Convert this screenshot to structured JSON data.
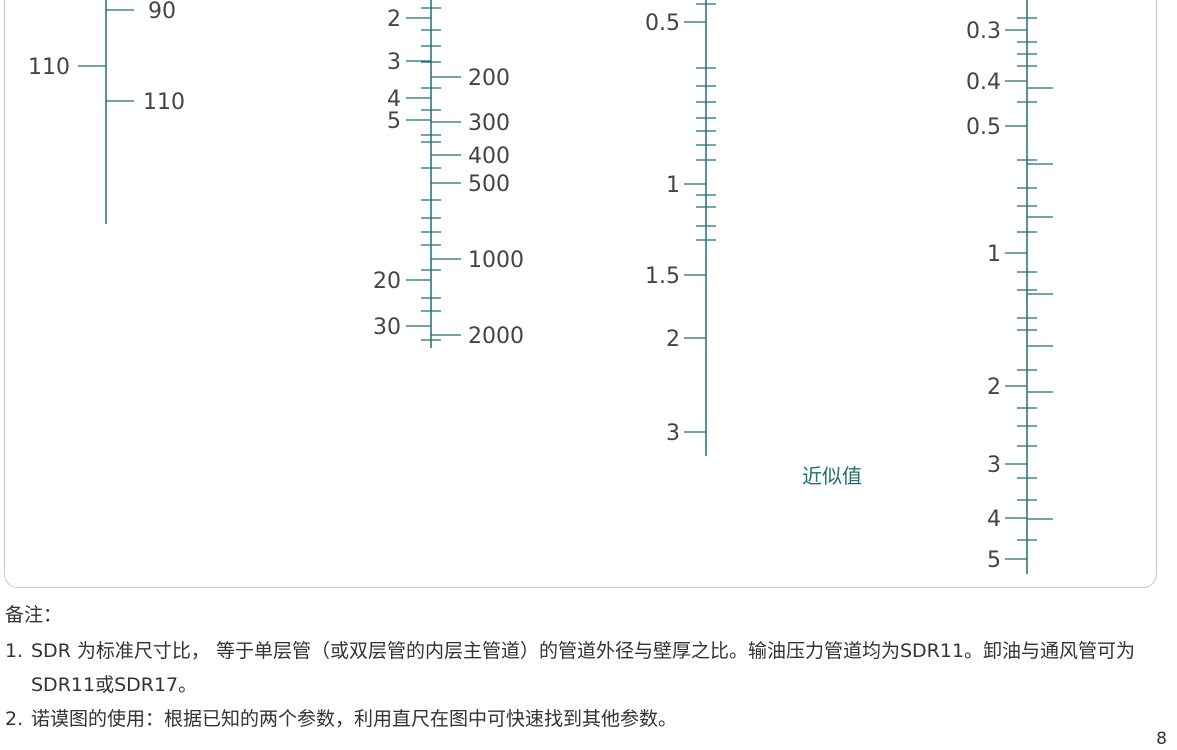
{
  "colors": {
    "axis": "#1f6f73",
    "text": "#444444",
    "frame": "#c8c8c8"
  },
  "chart_data": {
    "type": "nomogram",
    "annotation": "近似值",
    "axes": [
      {
        "name": "axis-1",
        "left_labels": [
          "110"
        ],
        "right_labels": [
          "90",
          "110"
        ]
      },
      {
        "name": "axis-2",
        "left_labels": [
          "2",
          "3",
          "4",
          "5",
          "20",
          "30"
        ],
        "right_labels": [
          "200",
          "300",
          "400",
          "500",
          "1000",
          "2000"
        ]
      },
      {
        "name": "axis-3",
        "left_labels": [
          "0.5",
          "1",
          "1.5",
          "2",
          "3"
        ],
        "right_labels": []
      },
      {
        "name": "axis-4",
        "left_labels": [
          "0.3",
          "0.4",
          "0.5",
          "1",
          "2",
          "3",
          "4",
          "5"
        ],
        "right_labels": []
      }
    ]
  },
  "notes": {
    "title": "备注：",
    "items": [
      {
        "num": "1.",
        "text": "SDR 为标准尺寸比， 等于单层管（或双层管的内层主管道）的管道外径与壁厚之比。输油压力管道均为SDR11。卸油与通风管可为SDR11或SDR17。"
      },
      {
        "num": "2.",
        "text": "诺谟图的使用：根据已知的两个参数，利用直尺在图中可快速找到其他参数。"
      }
    ]
  },
  "page_number": "8"
}
